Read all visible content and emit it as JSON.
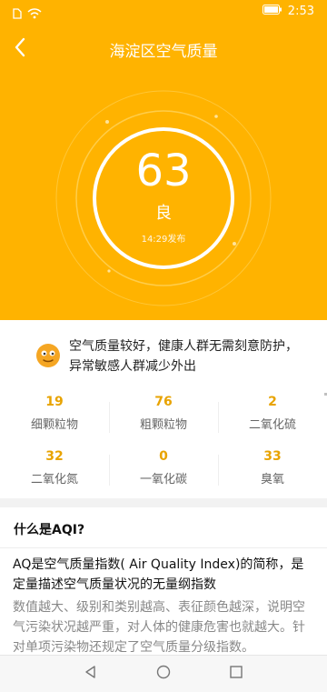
{
  "status_bar": {
    "time": "2:53",
    "icons": [
      "sim-icon",
      "wifi-icon",
      "battery-icon"
    ]
  },
  "header": {
    "title": "海淀区空气质量"
  },
  "aqi": {
    "value": "63",
    "level": "良",
    "published": "14:29发布"
  },
  "summary": {
    "face_icon": "smiley-face-icon",
    "text": "空气质量较好，健康人群无需刻意防护，异常敏感人群减少外出"
  },
  "pollutants": [
    {
      "value": "19",
      "name": "细颗粒物"
    },
    {
      "value": "76",
      "name": "粗颗粒物"
    },
    {
      "value": "2",
      "name": "二氧化硫"
    },
    {
      "value": "32",
      "name": "二氧化氮"
    },
    {
      "value": "0",
      "name": "一氧化碳"
    },
    {
      "value": "33",
      "name": "臭氧"
    }
  ],
  "about": {
    "title": "什么是AQI?",
    "definition": "AQ是空气质量指数( Air Quality Index)的简称，是定量描述空气质量状况的无量纲指数",
    "description": "数值越大、级别和类别越高、表征颜色越深，说明空气污染状况越严重，对人体的健康危害也就越大。针对单项污染物还规定了空气质量分级指数。"
  },
  "colors": {
    "hero": "#FFB300",
    "pollutant_value": "#E8A300"
  }
}
